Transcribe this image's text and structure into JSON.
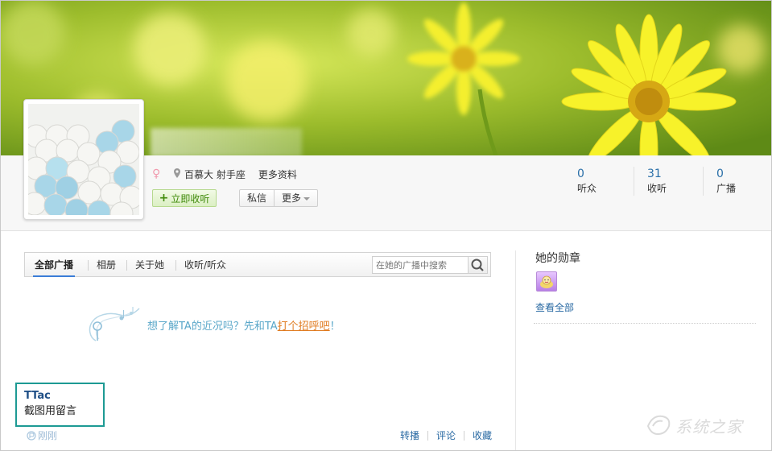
{
  "profile": {
    "location": "百慕大 射手座",
    "more_info": "更多资料",
    "follow_button": "立即收听",
    "message_button": "私信",
    "more_button": "更多"
  },
  "stats": [
    {
      "num": "0",
      "label": "听众"
    },
    {
      "num": "31",
      "label": "收听"
    },
    {
      "num": "0",
      "label": "广播"
    }
  ],
  "tabs": [
    {
      "label": "全部广播",
      "active": true
    },
    {
      "label": "相册"
    },
    {
      "label": "关于她"
    },
    {
      "label": "收听/听众"
    }
  ],
  "search": {
    "placeholder": "在她的广播中搜索"
  },
  "empty_state": {
    "text_before": "想了解TA的近况吗？先和TA",
    "link": "打个招呼吧",
    "text_after": "！"
  },
  "message": {
    "user": "TTac",
    "text": "截图用留言",
    "time": "刚刚"
  },
  "actions": [
    "转播",
    "评论",
    "收藏"
  ],
  "sidebar": {
    "title": "她的勋章",
    "view_all": "查看全部"
  },
  "watermark": "系统之家",
  "colors": {
    "accent": "#2a6aa3",
    "follow_green": "#3f8a0a",
    "highlight_border": "#1d9a94",
    "link_orange": "#e07c22"
  },
  "icons": [
    "female-icon",
    "location-icon",
    "plus-icon",
    "caret-down-icon",
    "search-icon",
    "music-note-icon",
    "repost-icon",
    "medal-icon"
  ]
}
